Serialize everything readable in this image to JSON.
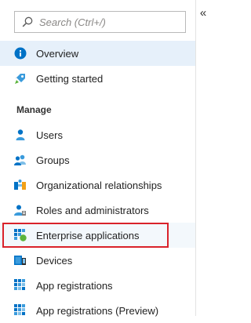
{
  "search": {
    "placeholder": "Search (Ctrl+/)"
  },
  "collapse_glyph": "«",
  "section_header": "Manage",
  "nav": {
    "overview": {
      "label": "Overview",
      "icon": "info-icon"
    },
    "getting_started": {
      "label": "Getting started",
      "icon": "rocket-icon"
    },
    "users": {
      "label": "Users",
      "icon": "user-icon"
    },
    "groups": {
      "label": "Groups",
      "icon": "group-icon"
    },
    "org_relationships": {
      "label": "Organizational relationships",
      "icon": "org-relationships-icon"
    },
    "roles": {
      "label": "Roles and administrators",
      "icon": "roles-icon"
    },
    "enterprise_apps": {
      "label": "Enterprise applications",
      "icon": "enterprise-apps-icon"
    },
    "devices": {
      "label": "Devices",
      "icon": "devices-icon"
    },
    "app_registrations": {
      "label": "App registrations",
      "icon": "app-registrations-icon"
    },
    "app_registrations_preview": {
      "label": "App registrations (Preview)",
      "icon": "app-registrations-preview-icon"
    }
  },
  "colors": {
    "accent_blue": "#0072c6",
    "active_bg": "#e6f0fa",
    "highlight_red": "#d9222a",
    "green": "#5bb33b"
  }
}
